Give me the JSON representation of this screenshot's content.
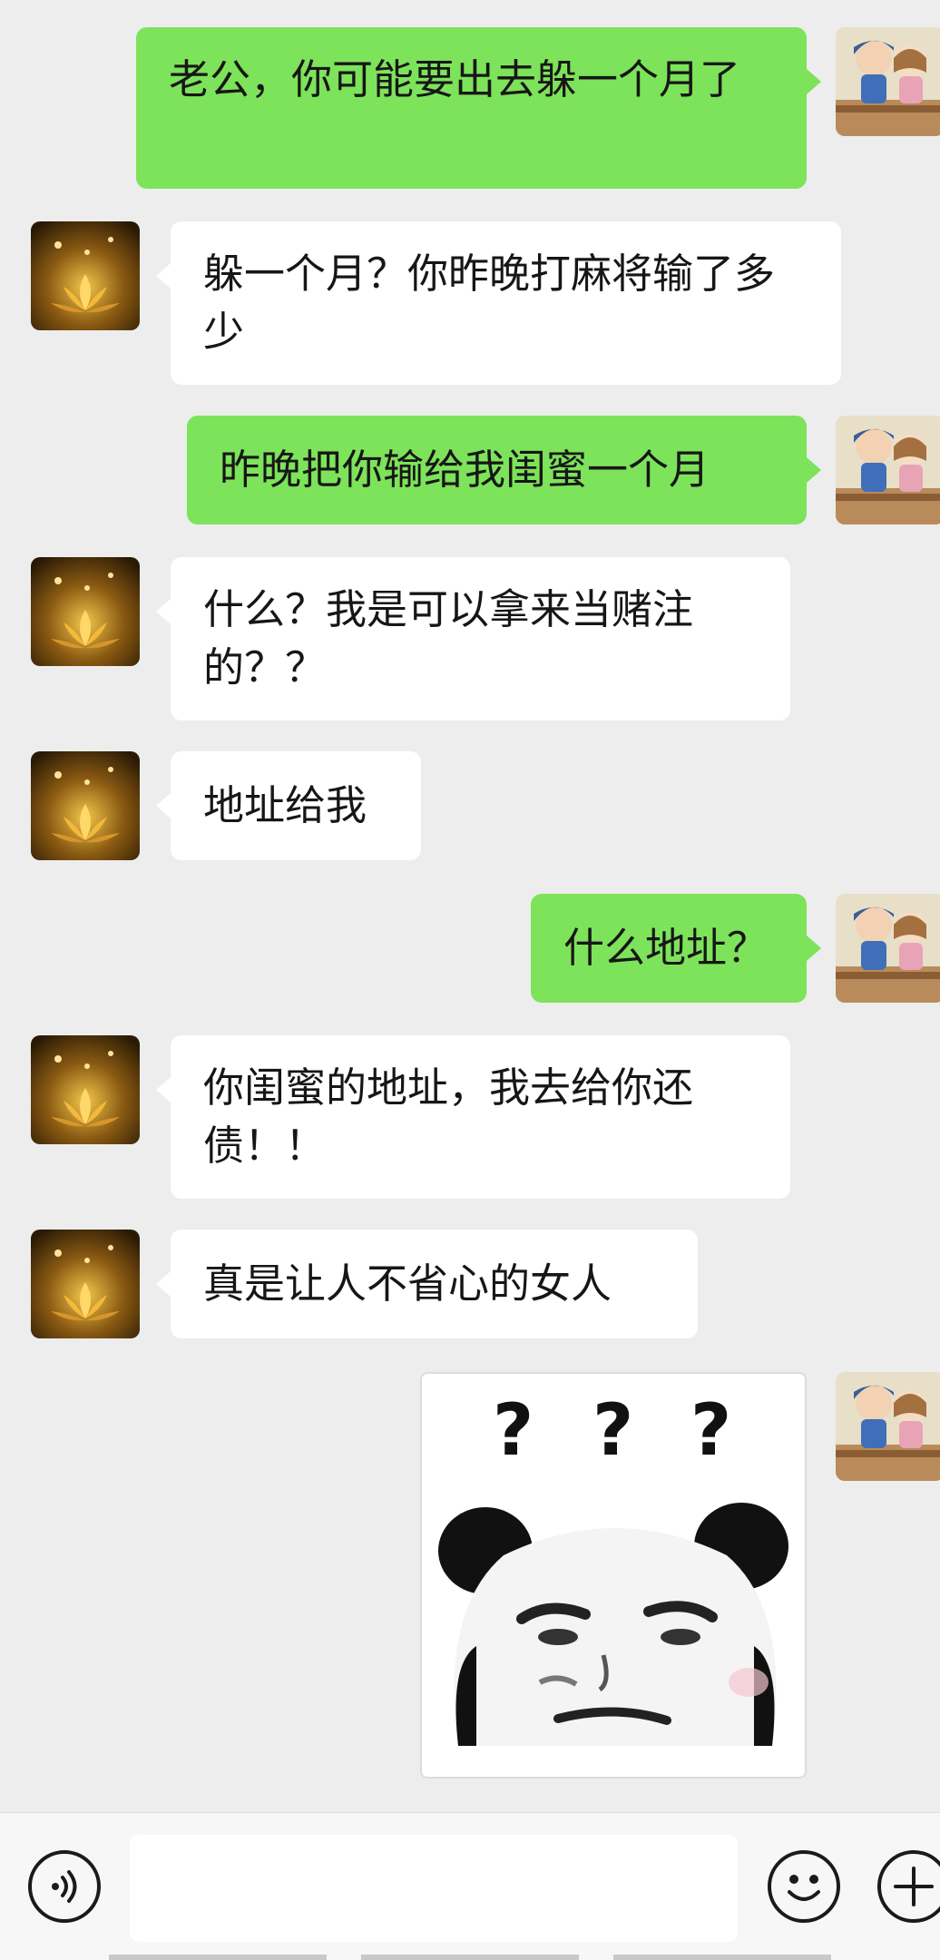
{
  "messages": [
    {
      "side": "out",
      "text": "老公，你可能要出去躲一个月了"
    },
    {
      "side": "in",
      "text": "躲一个月？你昨晚打麻将输了多少"
    },
    {
      "side": "out",
      "text": "昨晚把你输给我闺蜜一个月"
    },
    {
      "side": "in",
      "text": "什么？我是可以拿来当赌注的？？"
    },
    {
      "side": "in",
      "text": "地址给我"
    },
    {
      "side": "out",
      "text": "什么地址？"
    },
    {
      "side": "in",
      "text": "你闺蜜的地址，我去给你还债！！"
    },
    {
      "side": "in",
      "text": "真是让人不省心的女人"
    }
  ],
  "sticker": {
    "marks": [
      "?",
      "?",
      "?"
    ]
  },
  "input_bar": {
    "voice_icon": "voice-icon",
    "emoji_icon": "emoji-icon",
    "plus_icon": "plus-icon",
    "text_value": ""
  },
  "colors": {
    "background": "#ededed",
    "outgoing_bubble": "#7de35a",
    "incoming_bubble": "#ffffff"
  }
}
